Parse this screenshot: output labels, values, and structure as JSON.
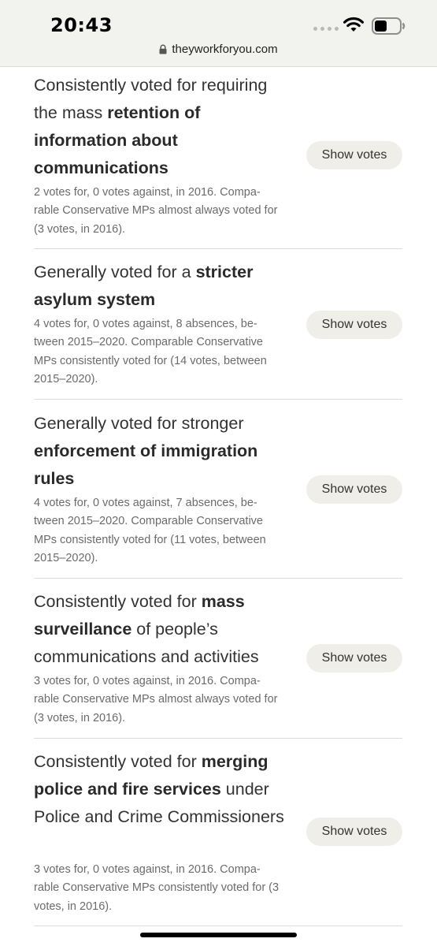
{
  "status_bar": {
    "time": "20:43",
    "url": "theyworkforyou.com",
    "icons": [
      "signal-dots-icon",
      "wifi-icon",
      "battery-icon",
      "lock-icon"
    ]
  },
  "votes": [
    {
      "pre": "Consistently voted for requiring the mass ",
      "bold": "retention of information about communications",
      "post": "",
      "detail": "2 votes for, 0 votes against, in 2016. Compa­rable Conservative MPs almost always voted for (3 votes, in 2016).",
      "button": "Show votes"
    },
    {
      "pre": "Generally voted for a ",
      "bold": "stricter asylum system",
      "post": "",
      "detail": "4 votes for, 0 votes against, 8 absences, be­tween 2015–2020. Comparable Conservative MPs consistently voted for (14 votes, be­tween 2015–2020).",
      "button": "Show votes"
    },
    {
      "pre": "Generally voted for stronger ",
      "bold": "enforcement of immigration rules",
      "post": "",
      "detail": "4 votes for, 0 votes against, 7 absences, be­tween 2015–2020. Comparable Conservative MPs consistently voted for (11 votes, be­tween 2015–2020).",
      "button": "Show votes"
    },
    {
      "pre": "Consistently voted for ",
      "bold": "mass surveillance",
      "post": " of people’s communications and activities",
      "detail": "3 votes for, 0 votes against, in 2016. Compa­rable Conservative MPs almost always voted for (3 votes, in 2016).",
      "button": "Show votes"
    },
    {
      "pre": "Consistently voted for ",
      "bold": "merging police and fire services",
      "post": " under Police and Crime Commissioners",
      "detail": "3 votes for, 0 votes against, in 2016. Compa­rable Conservative MPs consistently voted for (3 votes, in 2016).",
      "button": "Show votes"
    }
  ],
  "colors": {
    "status_bg": "#f2f2ef",
    "button_bg": "#efeee8",
    "detail_text": "#6b6b6b",
    "divider": "#dcdcd6"
  }
}
